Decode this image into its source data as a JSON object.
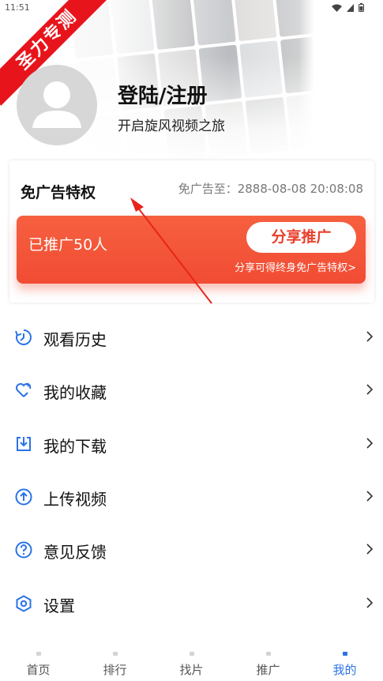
{
  "status_bar": {
    "time": "11:51"
  },
  "ribbon": {
    "text": "圣力专测"
  },
  "profile": {
    "title": "登陆/注册",
    "subtitle": "开启旋风视频之旅"
  },
  "adfree": {
    "title": "免广告特权",
    "expire": "免广告至：2888-08-08 20:08:08",
    "promo_count": "已推广50人",
    "share_button": "分享推广",
    "promo_note": "分享可得终身免广告特权>"
  },
  "menu": {
    "items": [
      {
        "label": "观看历史",
        "icon": "history-icon"
      },
      {
        "label": "我的收藏",
        "icon": "favorite-heart-icon"
      },
      {
        "label": "我的下载",
        "icon": "download-icon"
      },
      {
        "label": "上传视频",
        "icon": "upload-icon"
      },
      {
        "label": "意见反馈",
        "icon": "feedback-question-icon"
      },
      {
        "label": "设置",
        "icon": "settings-icon"
      }
    ]
  },
  "bottom_nav": {
    "items": [
      {
        "label": "首页"
      },
      {
        "label": "排行"
      },
      {
        "label": "找片"
      },
      {
        "label": "推广"
      },
      {
        "label": "我的",
        "active": true
      }
    ]
  },
  "colors": {
    "accent_blue": "#2a73e8",
    "promo_red": "#f14c34",
    "ribbon_red": "#e8141b"
  }
}
